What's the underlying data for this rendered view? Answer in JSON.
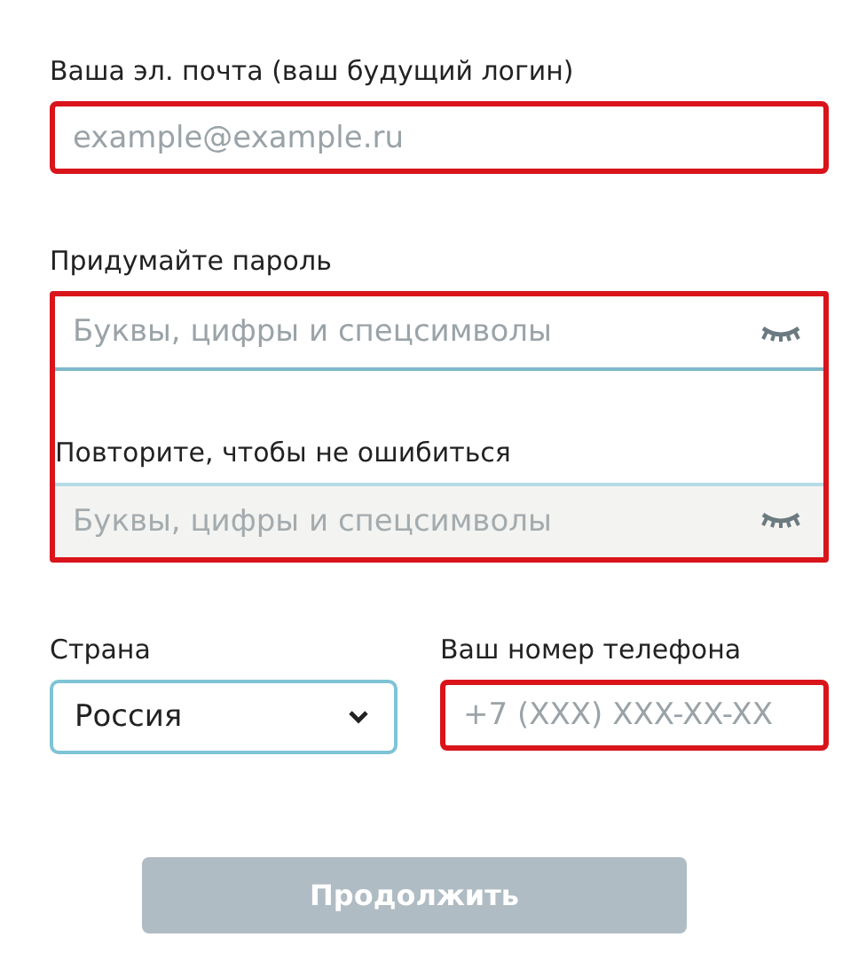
{
  "email": {
    "label": "Ваша эл. почта (ваш будущий логин)",
    "placeholder": "example@example.ru",
    "highlighted": true
  },
  "password": {
    "label": "Придумайте пароль",
    "placeholder": "Буквы, цифры и спецсимволы",
    "disabled": false
  },
  "password_repeat": {
    "label": "Повторите, чтобы не ошибиться",
    "placeholder": "Буквы, цифры и спецсимволы",
    "disabled": true
  },
  "password_group_highlighted": true,
  "country": {
    "label": "Страна",
    "value": "Россия"
  },
  "phone": {
    "label": "Ваш номер телефона",
    "placeholder": "+7 (XXX) XXX-XX-XX",
    "highlighted": true
  },
  "submit": {
    "label": "Продолжить",
    "disabled": true
  }
}
